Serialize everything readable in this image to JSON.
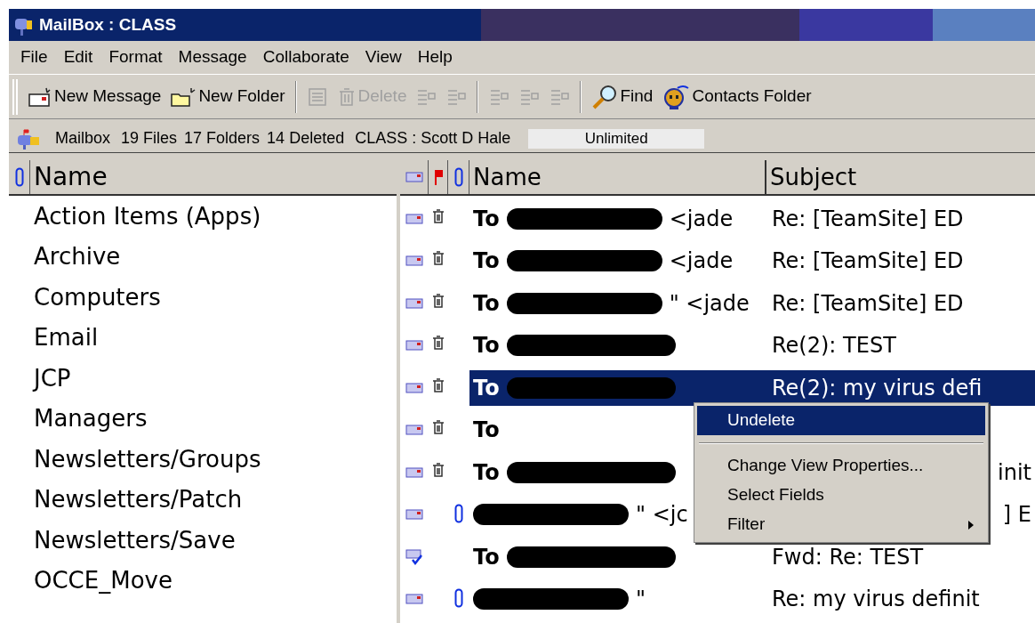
{
  "window": {
    "title": "MailBox : CLASS"
  },
  "menu": [
    "File",
    "Edit",
    "Format",
    "Message",
    "Collaborate",
    "View",
    "Help"
  ],
  "toolbar": [
    {
      "kind": "button",
      "label": "New Message",
      "disabled": false
    },
    {
      "kind": "button",
      "label": "New Folder",
      "disabled": false
    },
    {
      "kind": "separator"
    },
    {
      "kind": "button",
      "disabled": true
    },
    {
      "kind": "button",
      "label": "Delete",
      "disabled": true
    },
    {
      "kind": "button",
      "disabled": true
    },
    {
      "kind": "button",
      "disabled": true
    },
    {
      "kind": "separator"
    },
    {
      "kind": "button",
      "disabled": true
    },
    {
      "kind": "button",
      "disabled": true
    },
    {
      "kind": "button",
      "disabled": true
    },
    {
      "kind": "separator"
    },
    {
      "kind": "button",
      "label": "Find",
      "disabled": false
    },
    {
      "kind": "button",
      "label": "Contacts Folder",
      "disabled": false
    }
  ],
  "info_bar": {
    "location": "Mailbox",
    "files": "19 Files",
    "folders": "17 Folders",
    "deleted": "14 Deleted",
    "user": "CLASS : Scott D Hale",
    "quota": "Unlimited"
  },
  "folder_list": {
    "column": "Name",
    "items": [
      "Action Items (Apps)",
      "Archive",
      "Computers",
      "Email",
      "JCP",
      "Managers",
      "Newsletters/Groups",
      "Newsletters/Patch",
      "Newsletters/Save",
      "OCCE_Move"
    ]
  },
  "message_list": {
    "columns": [
      "Name",
      "Subject"
    ],
    "rows": [
      {
        "forwarded": false,
        "deleted": true,
        "attachment": false,
        "prefix": "To",
        "redacted": true,
        "suffix": "<jade",
        "subject": "Re: [TeamSite] ED",
        "subject_clipped": false,
        "selected": false
      },
      {
        "forwarded": false,
        "deleted": true,
        "attachment": false,
        "prefix": "To",
        "redacted": true,
        "suffix": "<jade",
        "subject": "Re: [TeamSite] ED",
        "subject_clipped": false,
        "selected": false
      },
      {
        "forwarded": false,
        "deleted": true,
        "attachment": false,
        "prefix": "To",
        "redacted": true,
        "suffix": "\" <jade",
        "subject": "Re: [TeamSite] ED",
        "subject_clipped": false,
        "selected": false
      },
      {
        "forwarded": false,
        "deleted": true,
        "attachment": false,
        "prefix": "To",
        "redacted": true,
        "subject": "Re(2): TEST",
        "subject_clipped": false,
        "selected": false
      },
      {
        "forwarded": false,
        "deleted": true,
        "attachment": false,
        "prefix": "To",
        "redacted": true,
        "subject": "Re(2): my virus defi",
        "subject_clipped": false,
        "selected": true
      },
      {
        "forwarded": false,
        "deleted": true,
        "attachment": false,
        "prefix": "To",
        "redacted": false,
        "subject_clipped": false,
        "selected": false
      },
      {
        "forwarded": false,
        "deleted": true,
        "attachment": false,
        "prefix": "To",
        "redacted": true,
        "subject": "init",
        "subject_clipped": true,
        "selected": false
      },
      {
        "forwarded": false,
        "deleted": false,
        "attachment": true,
        "redacted": true,
        "suffix": "\" <jc",
        "subject": "] E",
        "subject_clipped": true,
        "selected": false
      },
      {
        "forwarded": true,
        "deleted": false,
        "attachment": false,
        "prefix": "To",
        "redacted": true,
        "subject": "Fwd: Re: TEST",
        "subject_clipped": false,
        "selected": false
      },
      {
        "forwarded": false,
        "deleted": false,
        "attachment": true,
        "redacted": true,
        "suffix": "\"",
        "subject": "Re: my virus definit",
        "subject_clipped": false,
        "selected": false
      }
    ]
  },
  "context_menu": {
    "items": [
      {
        "kind": "item",
        "label": "Undelete",
        "selected": true
      },
      {
        "kind": "separator"
      },
      {
        "kind": "item",
        "label": "Change View Properties...",
        "selected": false
      },
      {
        "kind": "item",
        "label": "Select Fields",
        "selected": false
      },
      {
        "kind": "submenu",
        "label": "Filter",
        "selected": false
      }
    ]
  }
}
